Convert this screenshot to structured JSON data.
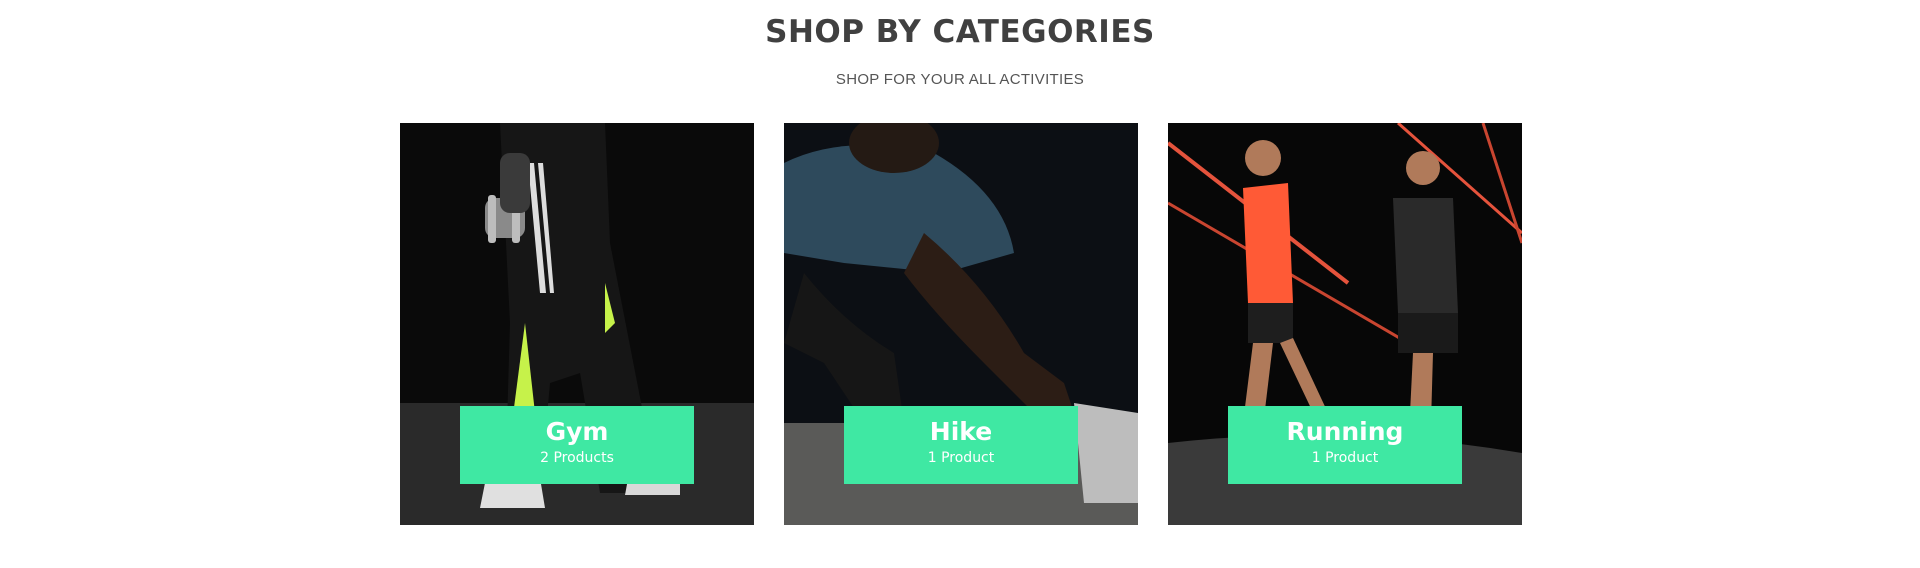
{
  "section": {
    "title": "SHOP BY CATEGORIES",
    "subtitle": "SHOP FOR YOUR ALL ACTIVITIES"
  },
  "categories": [
    {
      "name": "Gym",
      "count": "2 Products",
      "image_icon": "gym-photo-icon"
    },
    {
      "name": "Hike",
      "count": "1 Product",
      "image_icon": "hike-photo-icon"
    },
    {
      "name": "Running",
      "count": "1 Product",
      "image_icon": "running-photo-icon"
    }
  ],
  "colors": {
    "accent": "#3fe8a3",
    "title": "#404040",
    "photo_background": "#0b0b0b"
  }
}
